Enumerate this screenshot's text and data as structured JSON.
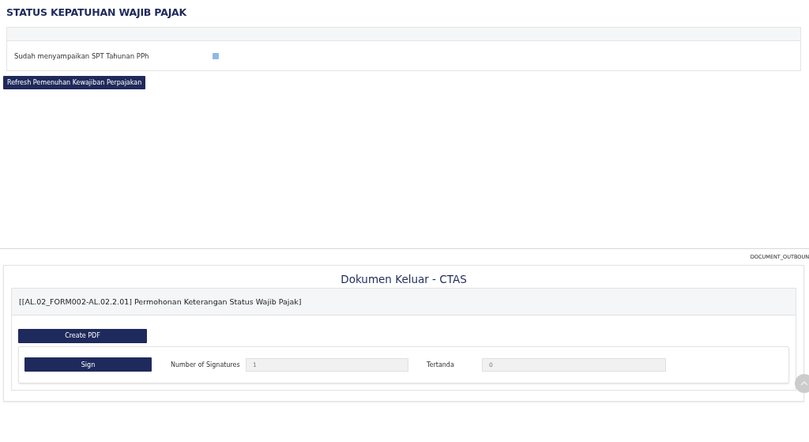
{
  "status_section": {
    "title": "STATUS KEPATUHAN WAJIB PAJAK",
    "rows": [
      {
        "label": "Sudah menyampaikan SPT Tahunan PPh",
        "checked": true
      }
    ],
    "refresh_button": "Refresh Pemenuhan Kewajiban Perpajakan"
  },
  "outbound_label": "DOCUMENT_OUTBOUN",
  "document_card": {
    "title": "Dokumen Keluar - CTAS",
    "form_title": "[[AL.02_FORM002-AL.02.2.01] Permohonan Keterangan Status Wajib Pajak]",
    "create_button": "Create PDF",
    "sign_button": "Sign",
    "fields": [
      {
        "label": "Number of Signatures",
        "value": "1"
      },
      {
        "label": "Tertanda",
        "value": "0"
      }
    ]
  }
}
